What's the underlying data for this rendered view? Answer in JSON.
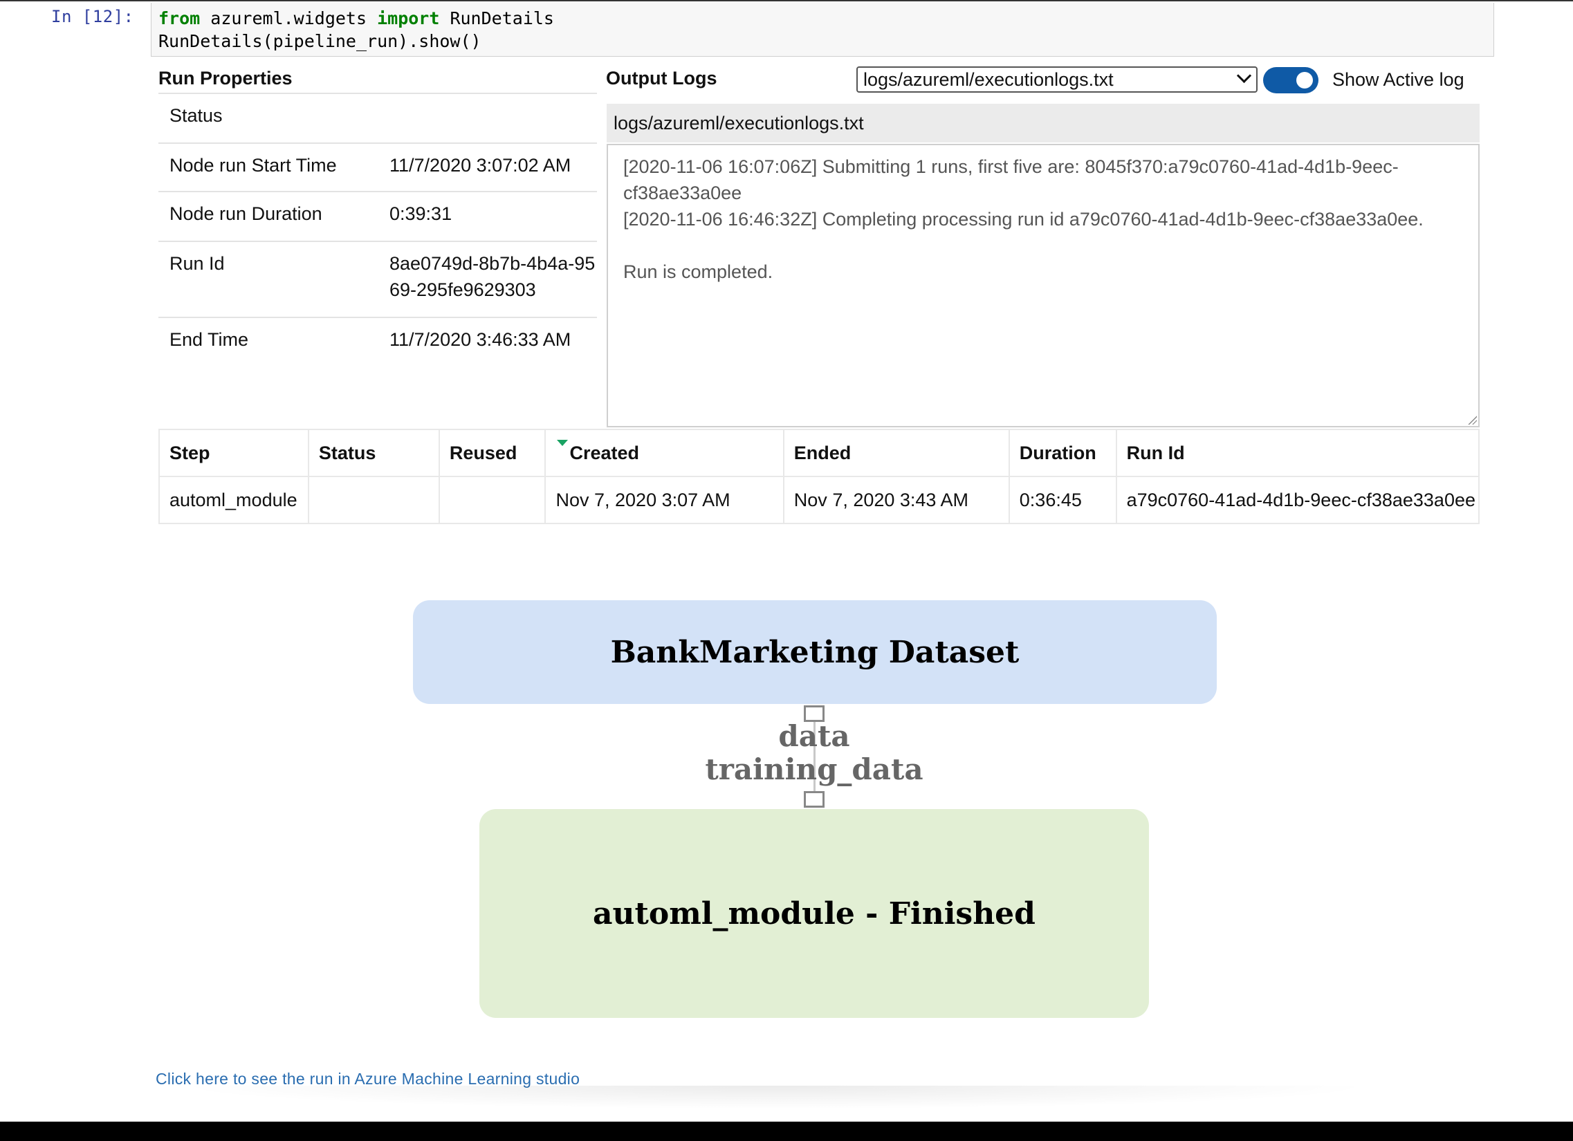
{
  "cell": {
    "prompt": "In [12]:",
    "code_line1_kw1": "from",
    "code_line1_mid": " azureml.widgets ",
    "code_line1_kw2": "import",
    "code_line1_end": " RunDetails",
    "code_line2": "RunDetails(pipeline_run).show()"
  },
  "run_properties": {
    "title": "Run Properties",
    "rows": [
      {
        "key": "Status",
        "value": ""
      },
      {
        "key": "Node run Start Time",
        "value": "11/7/2020 3:07:02 AM"
      },
      {
        "key": "Node run Duration",
        "value": "0:39:31"
      },
      {
        "key": "Run Id",
        "value": "8ae0749d-8b7b-4b4a-9569-295fe9629303"
      },
      {
        "key": "End Time",
        "value": "11/7/2020 3:46:33 AM"
      }
    ]
  },
  "output_logs": {
    "title": "Output Logs",
    "selected_log": "logs/azureml/executionlogs.txt",
    "toggle_label": "Show Active log",
    "toggle_on": true,
    "header": "logs/azureml/executionlogs.txt",
    "content": "[2020-11-06 16:07:06Z] Submitting 1 runs, first five are: 8045f370:a79c0760-41ad-4d1b-9eec-cf38ae33a0ee\n[2020-11-06 16:46:32Z] Completing processing run id a79c0760-41ad-4d1b-9eec-cf38ae33a0ee.\n\nRun is completed."
  },
  "steps_table": {
    "columns": [
      "Step",
      "Status",
      "Reused",
      "Created",
      "Ended",
      "Duration",
      "Run Id"
    ],
    "rows": [
      [
        "automl_module",
        "",
        "",
        "Nov 7, 2020 3:07 AM",
        "Nov 7, 2020 3:43 AM",
        "0:36:45",
        "a79c0760-41ad-4d1b-9eec-cf38ae33a0ee"
      ]
    ],
    "sort_indicator_color": "#19a363"
  },
  "graph": {
    "dataset_node": "BankMarketing Dataset",
    "output_port_label": "data",
    "input_port_label": "training_data",
    "module_node": "automl_module - Finished",
    "dataset_color": "#d3e2f7",
    "module_color": "#e2efd4"
  },
  "footer": {
    "studio_link": "Click here to see the run in Azure Machine Learning studio"
  },
  "colors": {
    "prompt": "#303f9f",
    "keyword": "#008000",
    "toggle": "#0f5aa6",
    "link": "#2a6db0"
  }
}
